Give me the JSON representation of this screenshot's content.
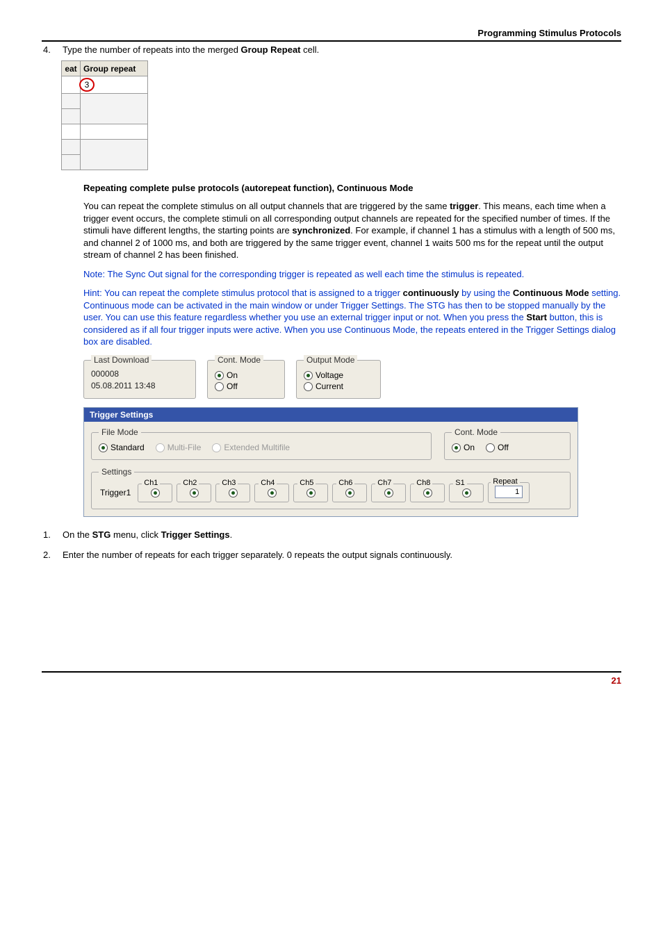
{
  "header": {
    "title": "Programming Stimulus Protocols"
  },
  "step4": {
    "num": "4.",
    "text_pre": "Type the number of repeats into the merged ",
    "bold": "Group Repeat",
    "text_post": " cell."
  },
  "grp_table": {
    "col1": "eat",
    "col2": "Group repeat",
    "val": "3"
  },
  "section_heading": "Repeating complete pulse protocols (autorepeat function), Continuous Mode",
  "para1": {
    "t1": "You can repeat the complete stimulus on all output channels that are triggered by the same ",
    "b1": "trigger",
    "t2": ". This means, each time when a trigger event occurs, the complete stimuli on all corresponding output channels are repeated for the specified number of times. If the stimuli have different lengths, the starting points are ",
    "b2": "synchronized",
    "t3": ". For example, if channel 1 has a stimulus with a length of 500 ms, and channel 2 of 1000 ms, and both are triggered by the same trigger event, channel 1 waits 500 ms for the repeat until the output stream of channel 2 has been finished."
  },
  "note": "Note: The Sync Out signal for the corresponding trigger is repeated as well each time the stimulus is repeated.",
  "hint": {
    "t1": "Hint: You can repeat the complete stimulus protocol that is assigned to a trigger ",
    "b1": "continuously",
    "t2": " by using the ",
    "b2": "Continuous Mode",
    "t3": " setting. Continuous mode can be activated in the main window or under Trigger Settings.  The STG has then to be stopped manually by the user. You can use this feature regardless whether you use an external trigger input or not. When you press the ",
    "b3": "Start",
    "t4": " button, this is considered as if all four trigger inputs were active. When you use Continuous Mode, the repeats entered in the Trigger Settings dialog box are disabled."
  },
  "gui1": {
    "last_download": {
      "legend": "Last Download",
      "l1": "000008",
      "l2": "05.08.2011 13:48"
    },
    "cont_mode": {
      "legend": "Cont. Mode",
      "on": "On",
      "off": "Off"
    },
    "output_mode": {
      "legend": "Output Mode",
      "voltage": "Voltage",
      "current": "Current"
    }
  },
  "trigger": {
    "title": "Trigger Settings",
    "file_mode": {
      "legend": "File Mode",
      "standard": "Standard",
      "multi": "Multi-File",
      "ext": "Extended Multifile"
    },
    "cont_mode": {
      "legend": "Cont. Mode",
      "on": "On",
      "off": "Off"
    },
    "settings": {
      "legend": "Settings",
      "trigger_label": "Trigger1",
      "channels": [
        "Ch1",
        "Ch2",
        "Ch3",
        "Ch4",
        "Ch5",
        "Ch6",
        "Ch7",
        "Ch8",
        "S1"
      ],
      "repeat_label": "Repeat",
      "repeat_value": "1"
    }
  },
  "step1": {
    "num": "1.",
    "t1": "On the ",
    "b1": "STG",
    "t2": " menu, click ",
    "b2": "Trigger Settings",
    "t3": "."
  },
  "step2": {
    "num": "2.",
    "text": "Enter the number of repeats for each trigger separately. 0 repeats the output signals continuously."
  },
  "page_number": "21"
}
